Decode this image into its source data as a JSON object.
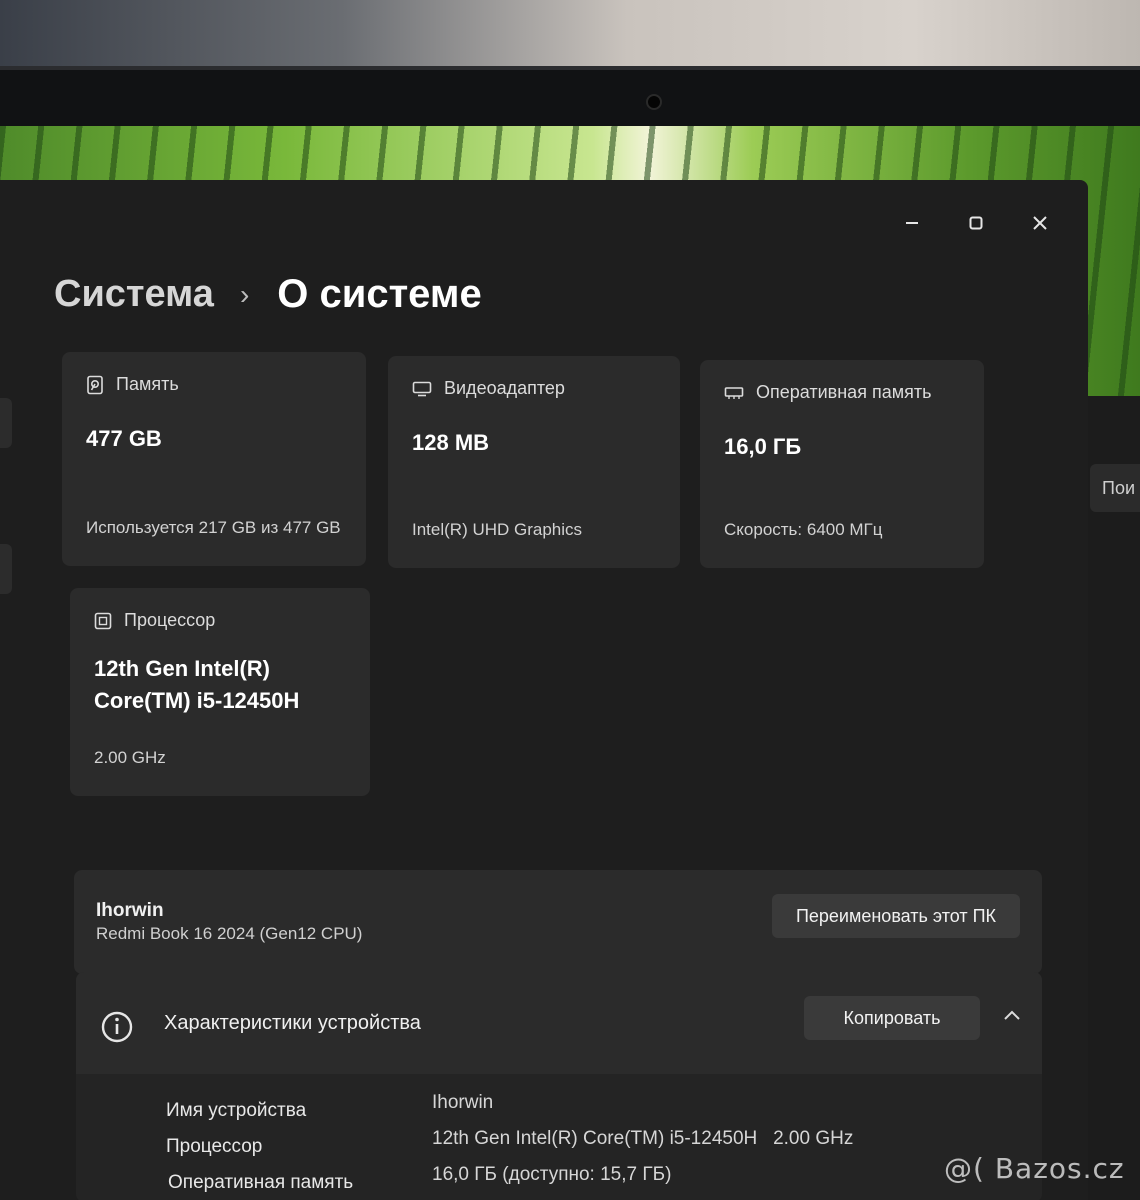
{
  "breadcrumb": {
    "root": "Система",
    "current": "О системе"
  },
  "cards": {
    "storage": {
      "title": "Память",
      "value": "477 GB",
      "sub": "Используется 217 GB из 477 GB"
    },
    "gpu": {
      "title": "Видеоадаптер",
      "value": "128 MB",
      "sub": "Intel(R) UHD Graphics"
    },
    "ram": {
      "title": "Оперативная память",
      "value": "16,0 ГБ",
      "sub": "Скорость: 6400 МГц"
    },
    "cpu": {
      "title": "Процессор",
      "value_line1": "12th Gen Intel(R)",
      "value_line2": "Core(TM) i5-12450H",
      "sub": "2.00 GHz"
    }
  },
  "device": {
    "name": "Ihorwin",
    "model": "Redmi Book 16 2024 (Gen12 CPU)",
    "rename_label": "Переименовать этот ПК"
  },
  "specs": {
    "title": "Характеристики устройства",
    "copy_label": "Копировать",
    "rows": [
      {
        "label": "Имя устройства",
        "value": "Ihorwin"
      },
      {
        "label": "Процессор",
        "value": "12th Gen Intel(R) Core(TM) i5-12450H   2.00 GHz"
      },
      {
        "label": "Оперативная память",
        "value": "16,0 ГБ (доступно: 15,7 ГБ)"
      }
    ]
  },
  "right_panel": {
    "search_partial": "Пои"
  },
  "watermark": "@( Bazos.cz"
}
